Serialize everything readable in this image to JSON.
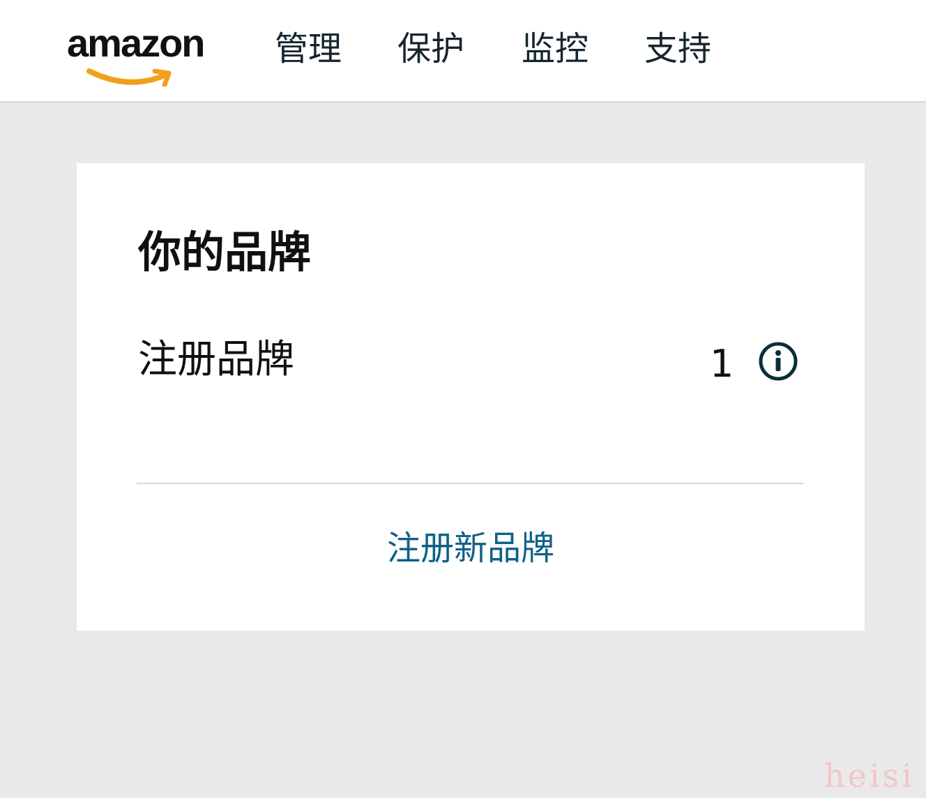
{
  "header": {
    "logo_text": "amazon",
    "nav": [
      {
        "label": "管理"
      },
      {
        "label": "保护"
      },
      {
        "label": "监控"
      },
      {
        "label": "支持"
      }
    ]
  },
  "brands_card": {
    "title": "你的品牌",
    "registered_label": "注册品牌",
    "registered_count": "1",
    "info_icon": "info-circle-icon",
    "register_new_link": "注册新品牌"
  },
  "watermark": "heisi",
  "colors": {
    "page_bg": "#e9e9ea",
    "logo_smile": "#f0a11b",
    "link": "#0f6187",
    "icon": "#0c2d3a"
  }
}
